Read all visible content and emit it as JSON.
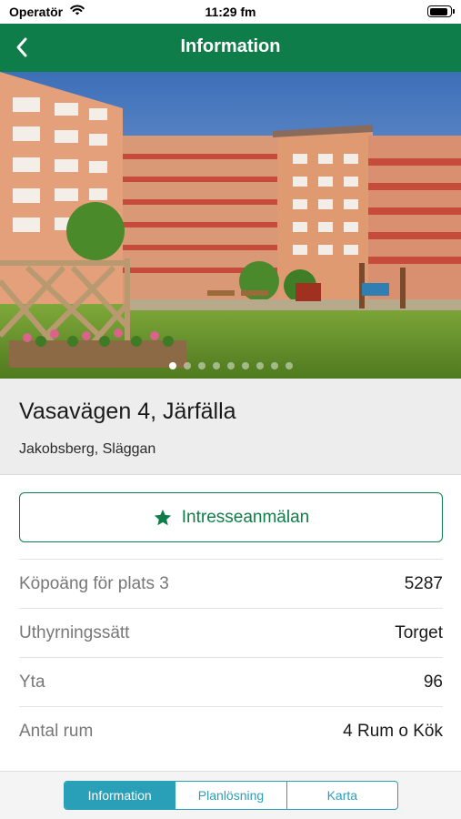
{
  "status_bar": {
    "carrier": "Operatör",
    "time": "11:29 fm",
    "battery_level": 0.9
  },
  "nav": {
    "title": "Information",
    "back_icon": "chevron-left-icon"
  },
  "photo": {
    "description_icon": "apartment-photo",
    "page_count": 9,
    "active_page": 0
  },
  "listing": {
    "address": "Vasavägen 4, Järfälla",
    "area": "Jakobsberg, Släggan"
  },
  "interest_button": {
    "label": "Intresseanmälan",
    "icon": "star-icon"
  },
  "details": [
    {
      "label": "Köpoäng för plats 3",
      "value": "5287"
    },
    {
      "label": "Uthyrningssätt",
      "value": "Torget"
    },
    {
      "label": "Yta",
      "value": "96"
    },
    {
      "label": "Antal rum",
      "value": "4 Rum o Kök"
    }
  ],
  "tabs": [
    {
      "label": "Information",
      "active": true
    },
    {
      "label": "Planlösning",
      "active": false
    },
    {
      "label": "Karta",
      "active": false
    }
  ],
  "colors": {
    "brand_green": "#0f7d4a",
    "tab_accent": "#2a9fb8"
  }
}
